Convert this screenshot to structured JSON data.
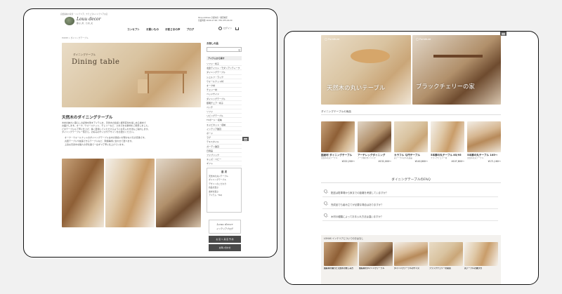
{
  "left": {
    "top_text": "自然素材の家具・インテリア。ナチュラルインテリアの店",
    "logo_script": "Louu decor",
    "logo_tag": "暮らしを、たのしむ",
    "shop_info_1": "Shop Address 京都市府・関西地区",
    "shop_info_2": "営業時間 10:00-17:00 / TEL 075-XX-XX",
    "nav": [
      "コンセプト",
      "お買いもの",
      "お客さまの声",
      "ブログ"
    ],
    "login": "ログイン",
    "breadcrumb": "HOME > ダイニングテーブル",
    "hero_sub": "ダイニングテーブル",
    "hero_title": "Dining table",
    "section_title": "天然木のダイニングテーブル",
    "body_lines": [
      "木材の魅力と暮らしの記憶を残すアイテムを、天然木の質感と経年変化を楽しめる素材で",
      "お届けします。オーク、ウォールナット、チェリーなど、さまざまな素材をご用意しました。",
      "どのテーブルも丁寧に仕上げ、長く愛用していただけるようにお手入れ方法もご案内します。",
      "ダイニングテーブル一覧から、お好みのサイズやデザインをお選びください。"
    ],
    "bullets": [
      "オーク・ウォールナットのダイニングテーブルは木の風合いが豊かな人気の定番です。",
      "丸型テーブルや拡張できるテーブルなど、家族構成に合わせて選べます。",
      "上質な天然木を職人の手仕事で一台ずつ丁寧に仕上げています。"
    ],
    "sidebar_search_title": "お探しの品",
    "sidebar_search_placeholder": "お探しの品を入力",
    "sidebar_category_head": "アイテムから探す",
    "sidebar_links": [
      "ソファ・椅子",
      "北欧テイスト・モダンアンティーク",
      "ダイニングテーブル",
      "シェルフ・ラック",
      "ウォールナット材",
      "オーク材",
      "チェリー材",
      "ベッドサイド",
      "ダイニングテーブル",
      "照明チェア・椅子",
      "ベンチ",
      "ソファ",
      "リビングテーブル",
      "TVボード・収納",
      "キャビネット・収納",
      "インテリア雑貨",
      "ボード",
      "ラグ",
      "テキスタイル",
      "ガーデン雑貨",
      "日用品",
      "ファブリック",
      "キッズ・ベビー",
      "ギフト"
    ],
    "sidebar_box_title": "目 次",
    "sidebar_box_links": [
      "天然木の丸いテーブル",
      "ダイニングテーブル",
      "デザインのこだわり",
      "商品を選ぶ",
      "素材を選ぶ",
      "アイテム・FAQ"
    ],
    "blog_banner": "インテリアブログ",
    "btn_dark_1": "お 店 へ 来 店 予 約",
    "btn_dark_2": "お問い合わせ"
  },
  "right": {
    "panel1_label": "Furniture",
    "panel1_caption": "天然木の丸いテーブル",
    "panel2_label": "Furniture",
    "panel2_caption": "ブラックチェリーの家",
    "list_heading": "ダイニングテーブルの商品",
    "products": [
      {
        "title": "国産材 ダイニングテーブル",
        "desc": "天然木の丸テーブル",
        "price": "¥222,200〜"
      },
      {
        "title": "アーチレッグダイニング",
        "desc": "アーチ脚のダイニング",
        "price": "¥132,000〜"
      },
      {
        "title": "カラフル な円テーブル",
        "desc": "丸テーブルの人気商品",
        "price": "¥140,800〜"
      },
      {
        "title": "5本脚の丸テーブル 85/95",
        "desc": "ブラックチェリー材",
        "price": "¥107,800〜"
      },
      {
        "title": "5本脚の丸テーブル 105〜",
        "desc": "天然木の丸テーブル",
        "price": "¥171,160〜"
      }
    ],
    "faq_heading": "ダイニングテーブルのFAQ",
    "faq": [
      "配送は駐車場から家までの距離を考慮していますか？",
      "完成品でも組み立てが必要な場合はありますか？",
      "木材の種類によってお手入れ方法は違いますか？"
    ],
    "articles_heading": "LOHAS インテリアについてのおはなし",
    "articles": [
      "国産材の魅力と天然木の楽しみ方",
      "無垢材のダイニングテーブル",
      "ダイニングテーブルのサイズ",
      "ブラックチェリーの家具",
      "丸テーブルの選び方"
    ]
  }
}
